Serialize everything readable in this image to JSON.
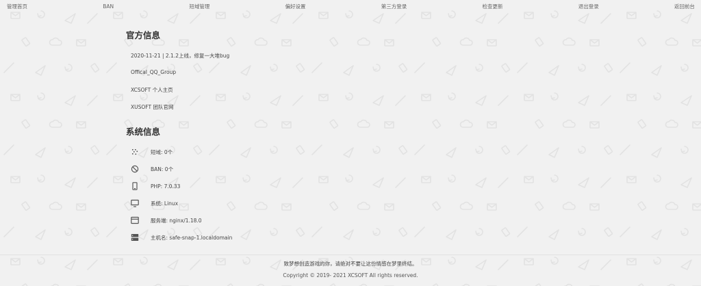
{
  "nav": {
    "items": [
      "管理首页",
      "BAN",
      "短域管理",
      "偏好设置",
      "第三方登录",
      "检查更新",
      "退出登录",
      "返回前台"
    ]
  },
  "official": {
    "title": "官方信息",
    "items": [
      "2020-11-21 | 2.1.2上线，修复一大堆bug",
      "Offical_QQ_Group",
      "XCSOFT 个人主页",
      "XUSOFT 团队官网"
    ]
  },
  "system": {
    "title": "系统信息",
    "items": [
      {
        "icon": "scatter-icon",
        "text": "短域: 0个"
      },
      {
        "icon": "ban-icon",
        "text": "BAN: 0个"
      },
      {
        "icon": "phone-icon",
        "text": "PHP: 7.0.33"
      },
      {
        "icon": "monitor-icon",
        "text": "系统: Linux"
      },
      {
        "icon": "browser-window-icon",
        "text": "服务端: nginx/1.18.0"
      },
      {
        "icon": "server-icon",
        "text": "主机名: safe-snap-1.localdomain"
      }
    ]
  },
  "footer": {
    "message": "致梦想创造游戏的你，请绝对不要让这份情感在梦里终结。",
    "copyright": "Copyright © 2019- 2021 XCSOFT All rights reserved."
  },
  "colors": {
    "background": "#f1f1f1",
    "pattern": "#e3e3e3",
    "text": "#333333"
  }
}
